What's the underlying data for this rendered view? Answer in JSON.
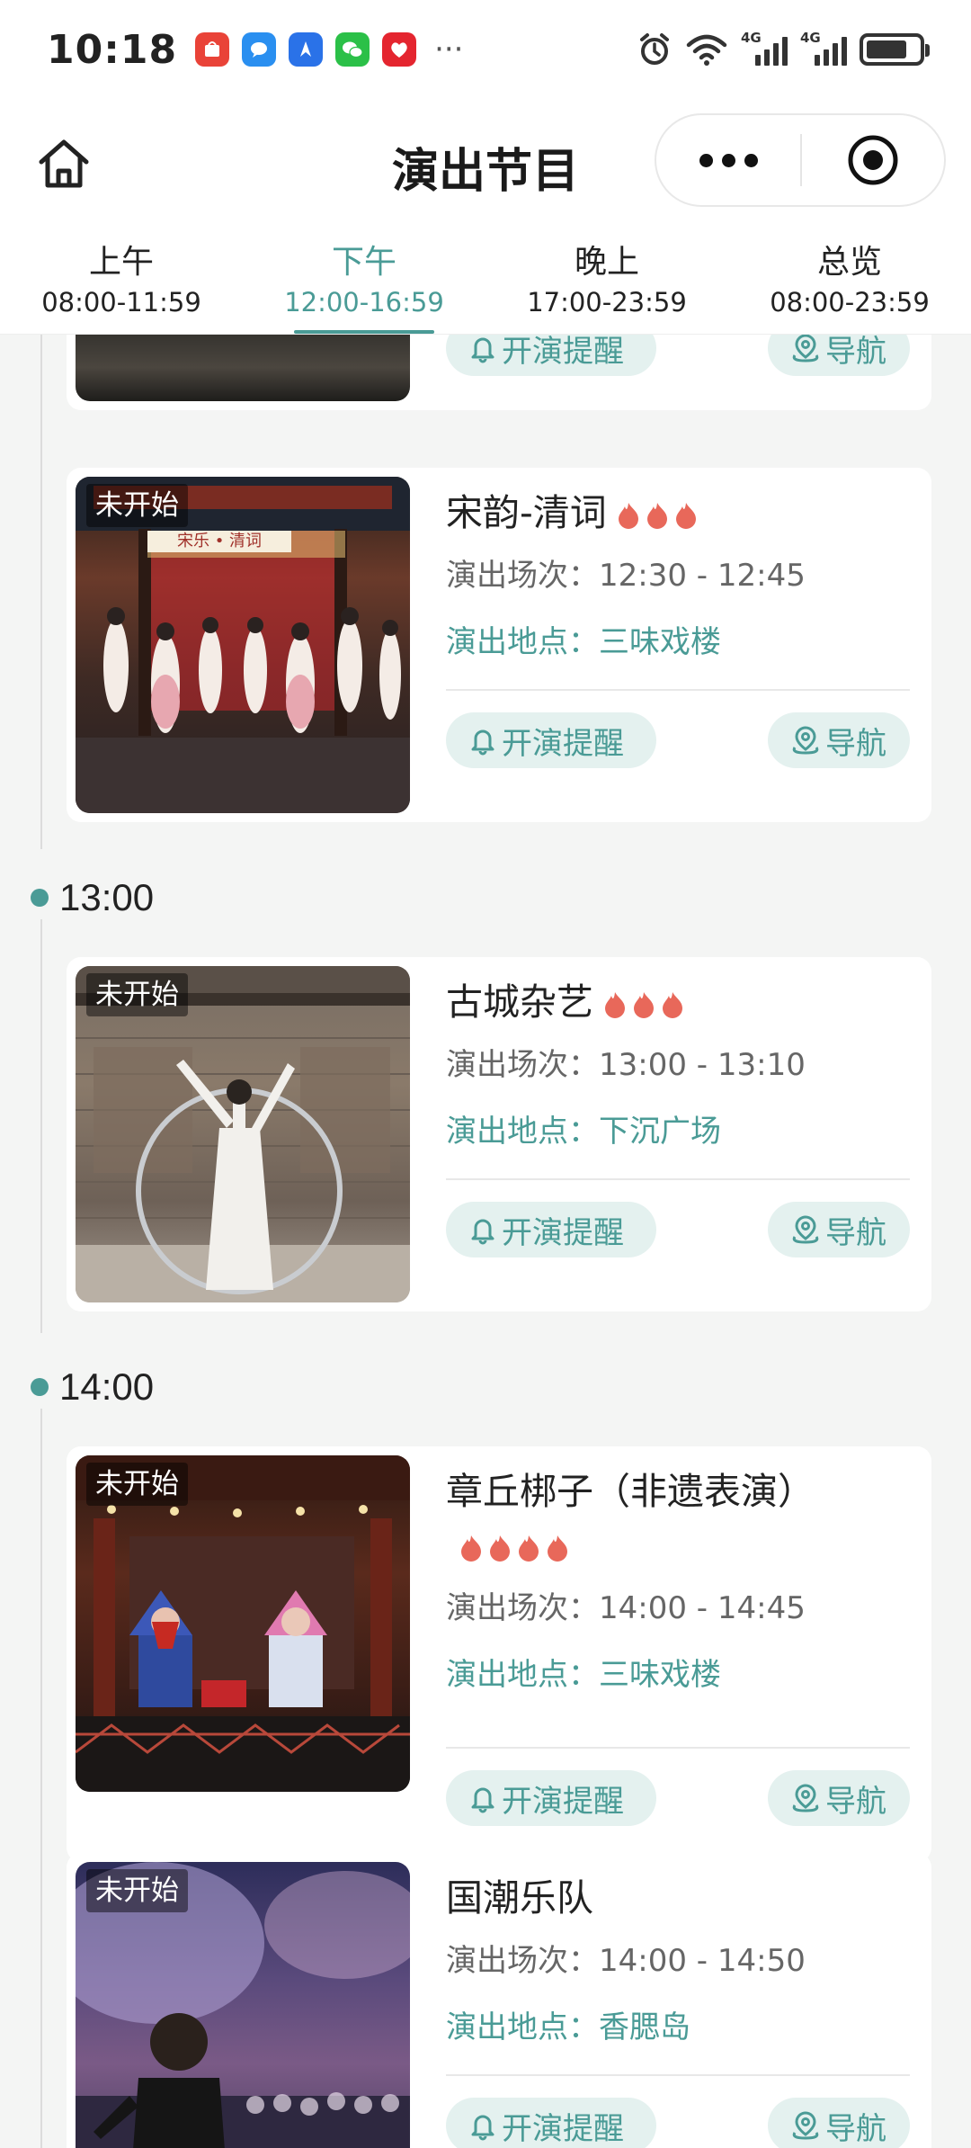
{
  "status_bar": {
    "time": "10:18",
    "apps": [
      {
        "name": "huawei-mall-icon",
        "color": "#e94338"
      },
      {
        "name": "messages-icon",
        "color": "#2a8ff0"
      },
      {
        "name": "navigation-app-icon",
        "color": "#2a72e8"
      },
      {
        "name": "wechat-icon",
        "color": "#2bc048"
      },
      {
        "name": "gift-app-icon",
        "color": "#e4252f"
      }
    ],
    "more": "···",
    "network_1": "4G",
    "network_2": "4G"
  },
  "nav": {
    "title": "演出节目"
  },
  "tabs": [
    {
      "name": "上午",
      "range": "08:00-11:59",
      "active": false
    },
    {
      "name": "下午",
      "range": "12:00-16:59",
      "active": true
    },
    {
      "name": "晚上",
      "range": "17:00-23:59",
      "active": false
    },
    {
      "name": "总览",
      "range": "08:00-23:59",
      "active": false
    }
  ],
  "labels": {
    "session_prefix": "演出场次：",
    "venue_prefix": "演出地点：",
    "remind_button": "开演提醒",
    "nav_button": "导航",
    "status_badge": "未开始"
  },
  "groups": [
    {
      "time": "13:00"
    },
    {
      "time": "14:00"
    }
  ],
  "shows": [
    {
      "title": "宋韵-清词",
      "flames": 3,
      "session": "12:30 - 12:45",
      "venue": "三味戏楼",
      "status": "未开始",
      "sign": "宋乐 • 清词"
    },
    {
      "title": "古城杂艺",
      "flames": 3,
      "session": "13:00 - 13:10",
      "venue": "下沉广场",
      "status": "未开始"
    },
    {
      "title": "章丘梆子（非遗表演）",
      "flames": 4,
      "session": "14:00 - 14:45",
      "venue": "三味戏楼",
      "status": "未开始"
    },
    {
      "title": "国潮乐队",
      "flames": 0,
      "session": "14:00 - 14:50",
      "venue": "香腮岛",
      "status": "未开始"
    }
  ],
  "colors": {
    "accent": "#4a9b96",
    "accent_light": "#e4f1ef",
    "flame": "#e8685a"
  }
}
